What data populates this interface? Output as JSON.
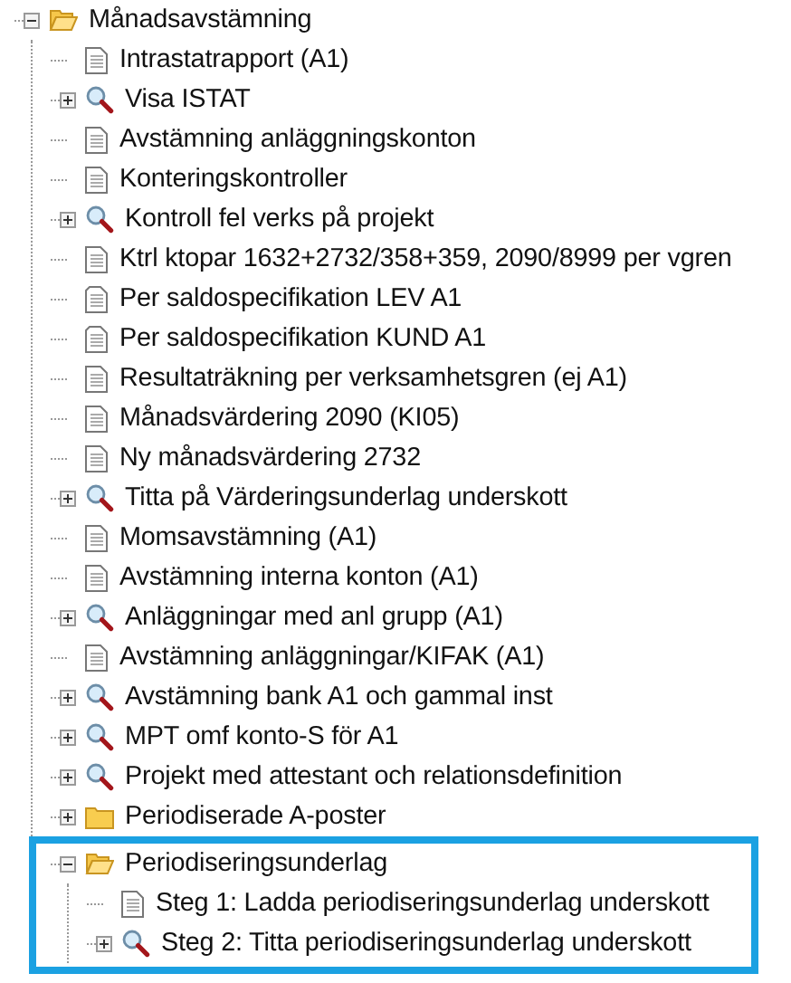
{
  "tree": [
    {
      "label": "Månadsavstämning",
      "kind": "folder",
      "expanded": true,
      "children": [
        {
          "label": "Intrastatrapport (A1)",
          "kind": "report"
        },
        {
          "label": "Visa ISTAT",
          "kind": "query",
          "expanded": false
        },
        {
          "label": "Avstämning anläggningskonton",
          "kind": "report"
        },
        {
          "label": "Konteringskontroller",
          "kind": "report"
        },
        {
          "label": "Kontroll fel verks på projekt",
          "kind": "query",
          "expanded": false
        },
        {
          "label": "Ktrl ktopar 1632+2732/358+359, 2090/8999 per vgren",
          "kind": "report"
        },
        {
          "label": "Per saldospecifikation LEV A1",
          "kind": "form"
        },
        {
          "label": "Per saldospecifikation KUND A1",
          "kind": "form"
        },
        {
          "label": "Resultaträkning per verksamhetsgren (ej A1)",
          "kind": "report"
        },
        {
          "label": "Månadsvärdering 2090 (KI05)",
          "kind": "report"
        },
        {
          "label": "Ny månadsvärdering 2732",
          "kind": "report"
        },
        {
          "label": "Titta på Värderingsunderlag underskott",
          "kind": "query",
          "expanded": false
        },
        {
          "label": "Momsavstämning (A1)",
          "kind": "report"
        },
        {
          "label": "Avstämning interna konton (A1)",
          "kind": "report"
        },
        {
          "label": "Anläggningar med anl grupp (A1)",
          "kind": "query",
          "expanded": false
        },
        {
          "label": "Avstämning anläggningar/KIFAK (A1)",
          "kind": "report"
        },
        {
          "label": "Avstämning bank A1 och gammal inst",
          "kind": "query",
          "expanded": false
        },
        {
          "label": "MPT omf konto-S för A1",
          "kind": "query",
          "expanded": false
        },
        {
          "label": "Projekt med attestant och relationsdefinition",
          "kind": "query",
          "expanded": false
        },
        {
          "label": "Periodiserade A-poster",
          "kind": "folder",
          "expanded": false
        },
        {
          "label": "Periodiseringsunderlag",
          "kind": "folder",
          "expanded": true,
          "highlighted": true,
          "children": [
            {
              "label": "Steg 1: Ladda periodiseringsunderlag underskott",
              "kind": "report"
            },
            {
              "label": "Steg 2: Titta periodiseringsunderlag underskott",
              "kind": "query",
              "expanded": false
            }
          ]
        }
      ]
    }
  ]
}
